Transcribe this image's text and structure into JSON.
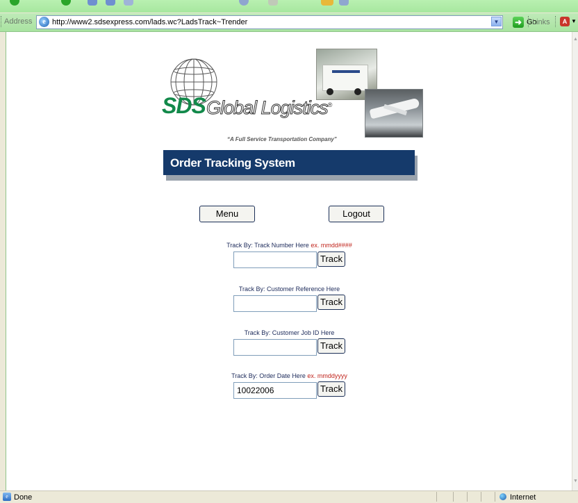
{
  "browser": {
    "address_label": "Address",
    "url": "http://www2.sdsexpress.com/lads.wc?LadsTrack~Trender",
    "go_label": "Go",
    "links_label": "Links"
  },
  "logo": {
    "brand_sds": "SDS",
    "brand_rest": "Global Logistics",
    "registered": "®",
    "tagline": "“A Full Service Transportation Company”"
  },
  "banner": {
    "title": "Order Tracking System"
  },
  "nav": {
    "menu_label": "Menu",
    "logout_label": "Logout"
  },
  "tracking": [
    {
      "label": "Track By: Track Number Here",
      "hint": "ex. mmdd####",
      "value": "",
      "button": "Track"
    },
    {
      "label": "Track By: Customer Reference Here",
      "hint": "",
      "value": "",
      "button": "Track"
    },
    {
      "label": "Track By: Customer Job ID Here",
      "hint": "",
      "value": "",
      "button": "Track"
    },
    {
      "label": "Track By: Order Date Here",
      "hint": "ex. mmddyyyy",
      "value": "10022006",
      "button": "Track"
    }
  ],
  "status": {
    "text": "Done",
    "zone": "Internet"
  },
  "colors": {
    "banner": "#153a6b",
    "brand_green": "#12894a",
    "hint_red": "#c0241c",
    "label_navy": "#1c2a5a"
  }
}
